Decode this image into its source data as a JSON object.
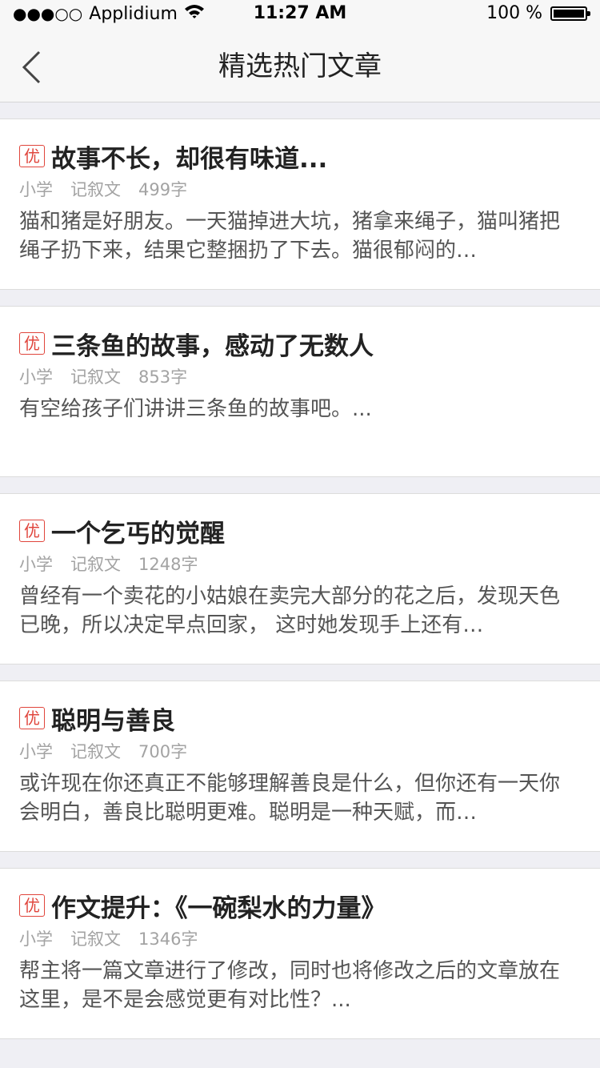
{
  "status_bar": {
    "signal": "●●●○○",
    "carrier": "Applidium",
    "time": "11:27 AM",
    "battery_text": "100 %",
    "battery_level": 1.0
  },
  "nav": {
    "back_icon": "chevron-left-icon",
    "title": "精选热门文章"
  },
  "articles": [
    {
      "badge": "优",
      "title": "故事不长，却很有味道...",
      "level": "小学",
      "genre": "记叙文",
      "words": "499字",
      "summary": "猫和猪是好朋友。一天猫掉进大坑，猪拿来绳子，猫叫猪把绳子扔下来，结果它整捆扔了下去。猫很郁闷的…"
    },
    {
      "badge": "优",
      "title": "三条鱼的故事，感动了无数人",
      "level": "小学",
      "genre": "记叙文",
      "words": "853字",
      "summary": "有空给孩子们讲讲三条鱼的故事吧。..."
    },
    {
      "badge": "优",
      "title": "一个乞丐的觉醒",
      "level": "小学",
      "genre": "记叙文",
      "words": "1248字",
      "summary": "曾经有一个卖花的小姑娘在卖完大部分的花之后，发现天色已晚，所以决定早点回家， 这时她发现手上还有…"
    },
    {
      "badge": "优",
      "title": "聪明与善良",
      "level": "小学",
      "genre": "记叙文",
      "words": "700字",
      "summary": "或许现在你还真正不能够理解善良是什么，但你还有一天你会明白，善良比聪明更难。聪明是一种天赋，而…"
    },
    {
      "badge": "优",
      "title": "作文提升：《一碗梨水的力量》",
      "level": "小学",
      "genre": "记叙文",
      "words": "1346字",
      "summary": "帮主将一篇文章进行了修改，同时也将修改之后的文章放在这里，是不是会感觉更有对比性？..."
    }
  ],
  "colors": {
    "accent": "#e0453c",
    "background": "#efeff4",
    "nav_background": "#f7f7f7"
  }
}
